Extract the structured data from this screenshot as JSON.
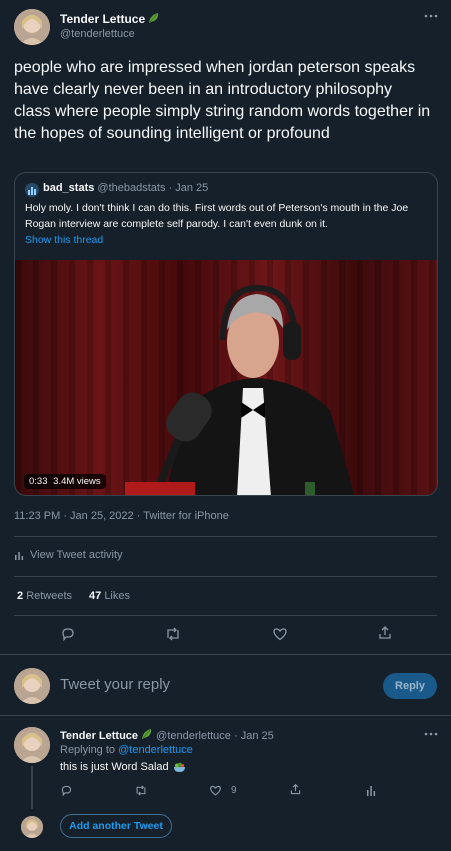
{
  "tweet": {
    "author_name": "Tender Lettuce",
    "author_handle": "@tenderlettuce",
    "text": "people who are impressed when jordan peterson speaks have clearly never been in an introductory philosophy class where people simply string random words together in the hopes of sounding intelligent or profound",
    "timestamp": "11:23 PM · Jan 25, 2022 · Twitter for iPhone",
    "activity_label": "View Tweet activity",
    "retweets_count": "2",
    "retweets_label": "Retweets",
    "likes_count": "47",
    "likes_label": "Likes"
  },
  "quote": {
    "author_name": "bad_stats",
    "author_handle": "@thebadstats",
    "date": "· Jan 25",
    "text": "Holy moly. I don't think I can do this. First words out of Peterson's mouth in the Joe Rogan interview are complete self parody. I can't even dunk on it.",
    "show_thread": "Show this thread",
    "video_duration": "0:33",
    "video_views": "3.4M views"
  },
  "reply_box": {
    "placeholder": "Tweet your reply",
    "button_label": "Reply"
  },
  "reply": {
    "author_name": "Tender Lettuce",
    "author_handle": "@tenderlettuce",
    "date": "· Jan 25",
    "replying_to_label": "Replying to",
    "replying_to_handle": "@tenderlettuce",
    "text": "this is just Word Salad",
    "likes_count": "9"
  },
  "add_another_label": "Add another Tweet",
  "colors": {
    "background": "#15202b",
    "accent": "#1d9bf0",
    "muted": "#8b98a5",
    "border": "#38444d"
  }
}
